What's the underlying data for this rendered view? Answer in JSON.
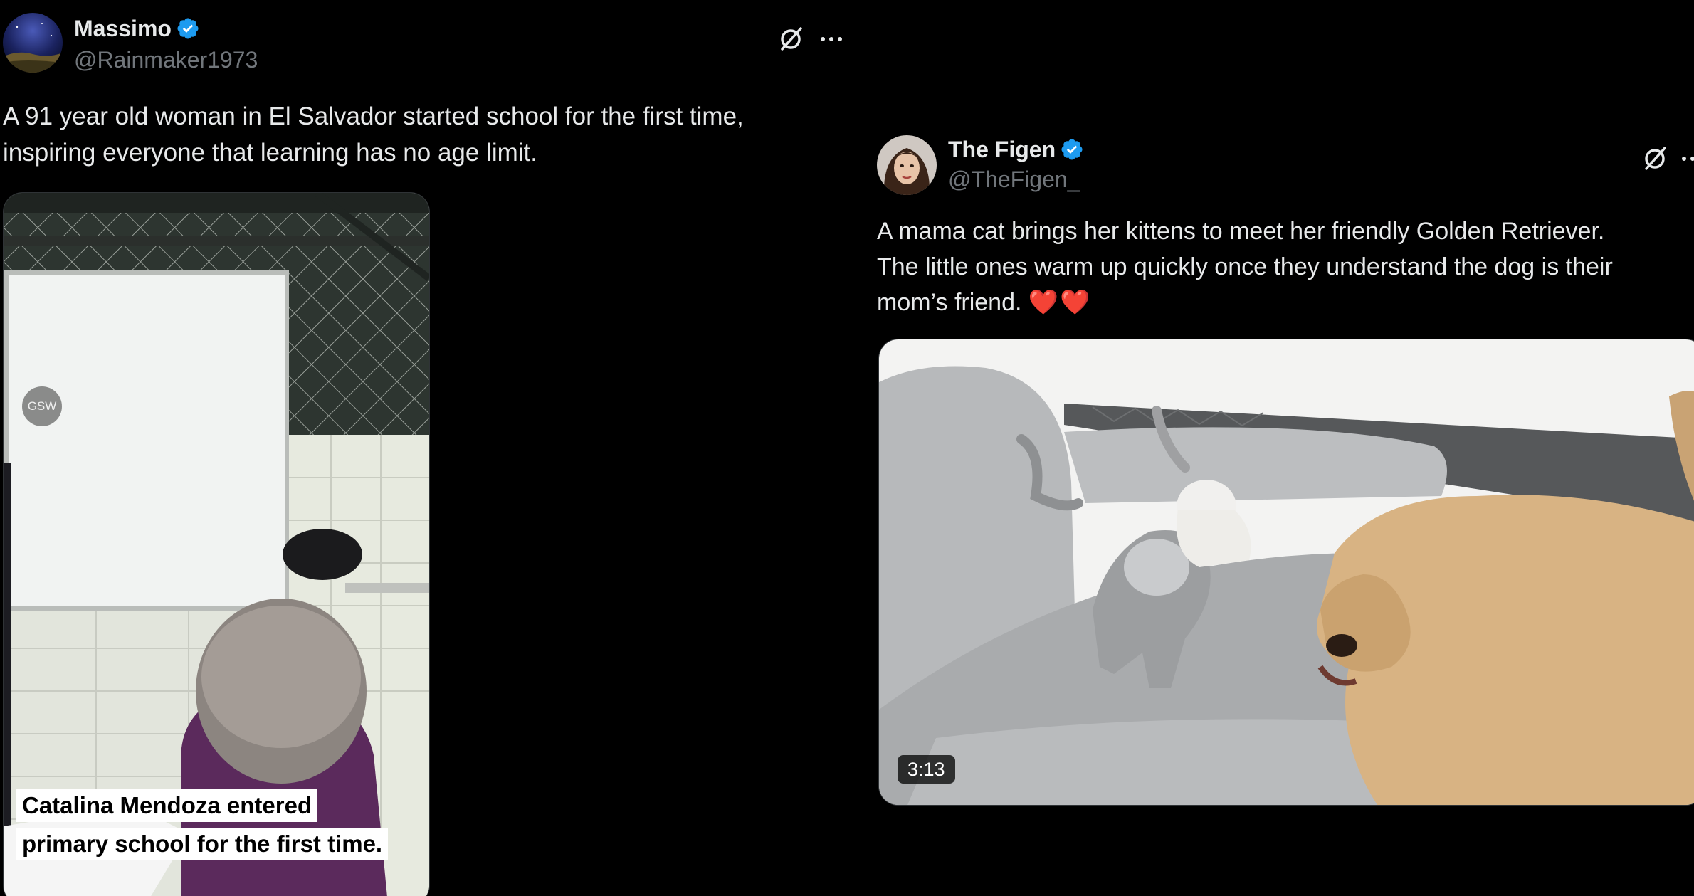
{
  "tweets": [
    {
      "display_name": "Massimo",
      "handle": "@Rainmaker1973",
      "verified": true,
      "text_lines": [
        "A 91 year old woman in El Salvador started school for the first time,",
        "inspiring everyone that learning has no age limit."
      ],
      "media": {
        "type": "video",
        "watermark": "GSW",
        "caption_lines": [
          "Catalina Mendoza entered",
          "primary school for the first time."
        ]
      },
      "icons": [
        "grok-icon",
        "more-icon"
      ]
    },
    {
      "display_name": "The Figen",
      "handle": "@TheFigen_",
      "verified": true,
      "text_lines": [
        "A mama cat brings her kittens to meet her friendly Golden Retriever.",
        "The little ones warm up quickly once they understand the dog is their",
        "mom’s friend."
      ],
      "emoji": "❤️❤️",
      "media": {
        "type": "video",
        "duration": "3:13"
      },
      "icons": [
        "grok-icon",
        "more-icon"
      ]
    }
  ],
  "colors": {
    "background": "#000000",
    "text": "#e7e9ea",
    "secondary_text": "#71767b",
    "verified_badge": "#1d9bf0",
    "heart": "#e0263a"
  }
}
